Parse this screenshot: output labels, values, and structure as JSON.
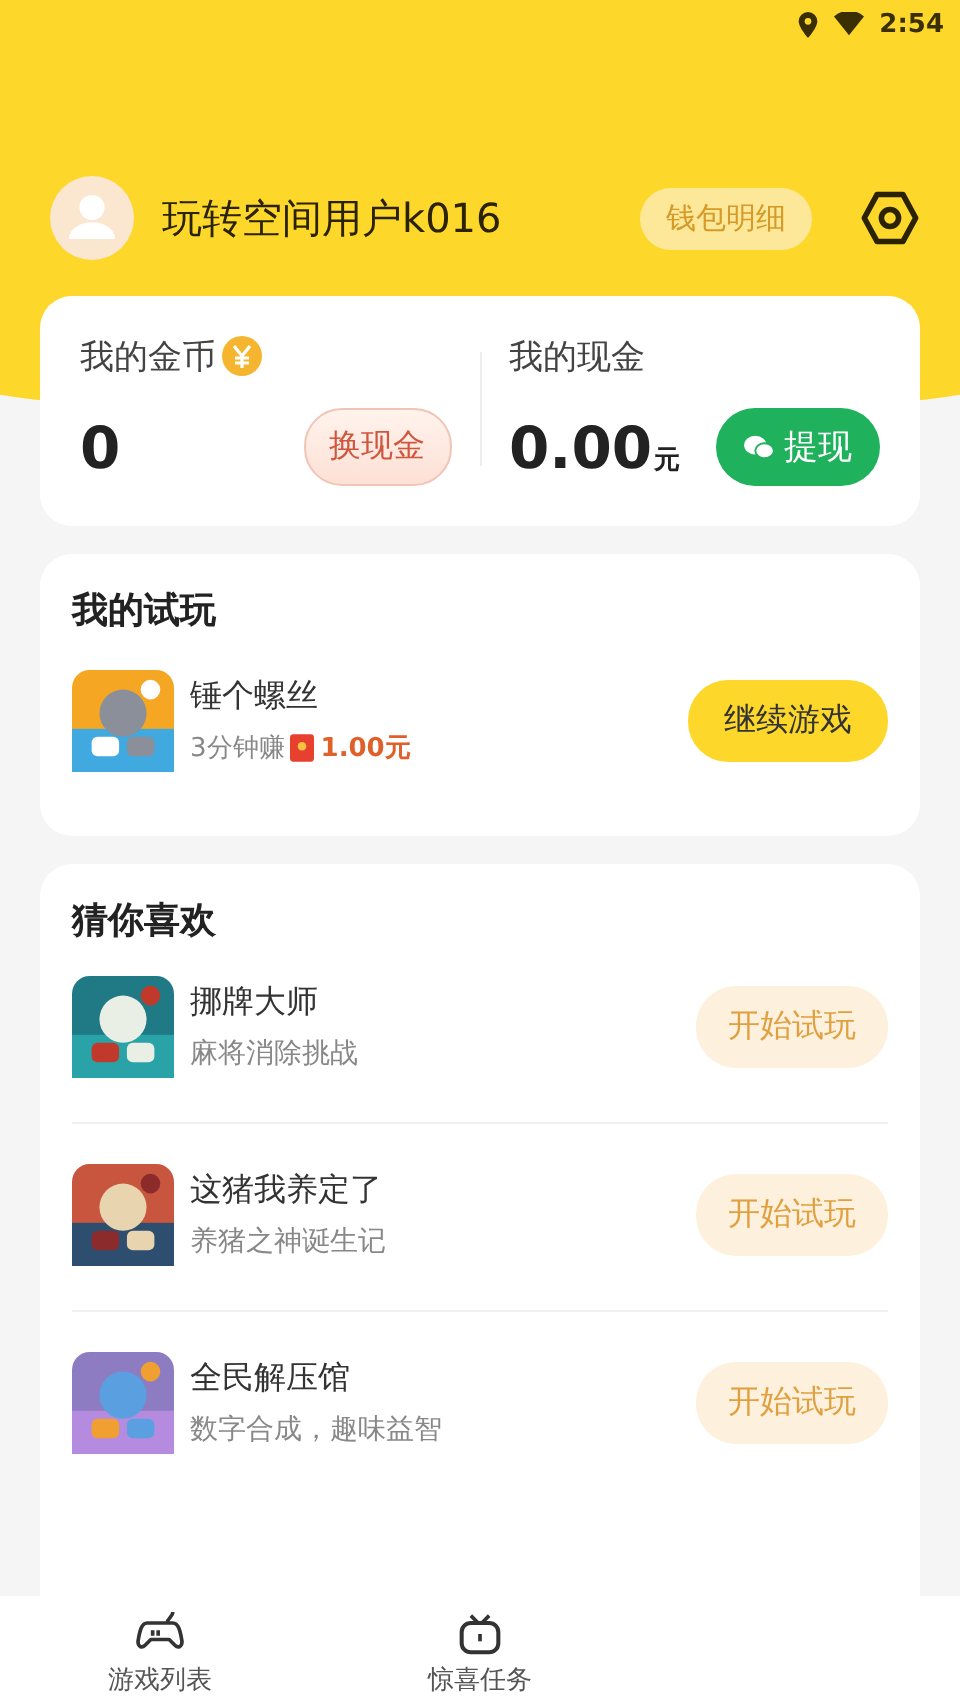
{
  "status_bar": {
    "time": "2:54"
  },
  "profile": {
    "username": "玩转空间用户k016",
    "wallet_button": "钱包明细"
  },
  "wallet": {
    "coins_label": "我的金币",
    "coins_value": "0",
    "exchange_button": "换现金",
    "cash_label": "我的现金",
    "cash_value": "0.00",
    "cash_unit": "元",
    "withdraw_button": "提现"
  },
  "my_trials": {
    "title": "我的试玩",
    "games": [
      {
        "name": "锤个螺丝",
        "reward_text": "3分钟赚",
        "reward_amount": "1.00元",
        "button": "继续游戏",
        "kind": "picture"
      }
    ]
  },
  "recommend": {
    "title": "猜你喜欢",
    "games": [
      {
        "name": "挪牌大师",
        "subtitle": "麻将消除挑战",
        "button": "开始试玩",
        "kind": "picture"
      },
      {
        "name": "这猪我养定了",
        "subtitle": "养猪之神诞生记",
        "button": "开始试玩",
        "kind": "picture"
      },
      {
        "name": "全民解压馆",
        "subtitle": "数字合成，趣味益智",
        "button": "开始试玩",
        "kind": "picture"
      }
    ]
  },
  "tab_bar": {
    "tabs": [
      {
        "label": "游戏列表"
      },
      {
        "label": "惊喜任务"
      }
    ]
  }
}
